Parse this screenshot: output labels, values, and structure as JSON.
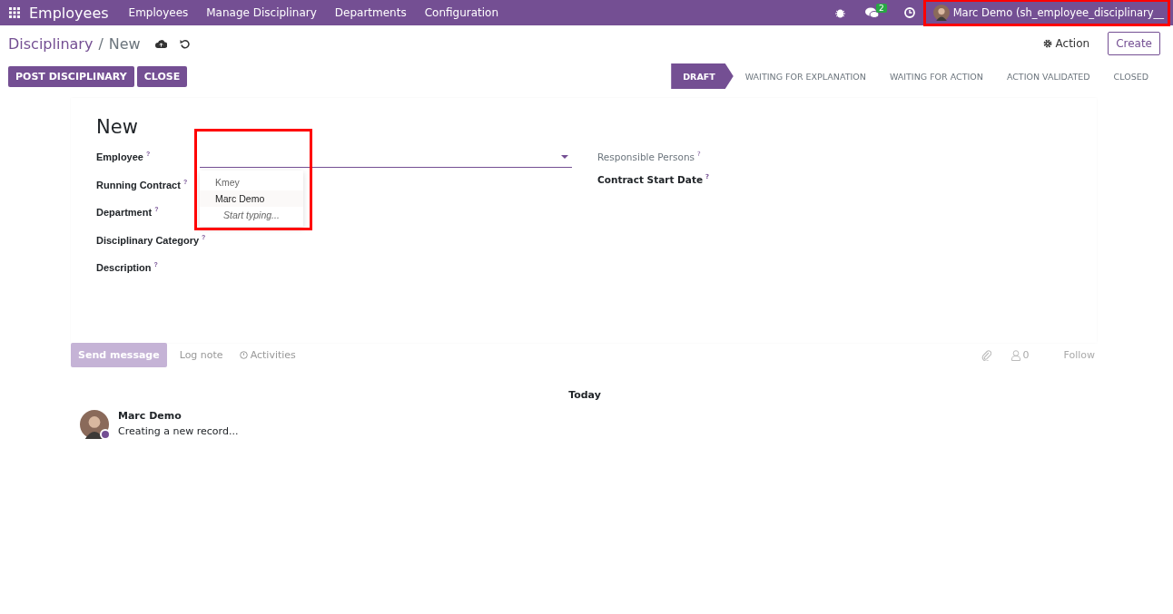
{
  "navbar": {
    "app_name": "Employees",
    "menu": [
      "Employees",
      "Manage Disciplinary",
      "Departments",
      "Configuration"
    ],
    "messages_count": "2",
    "user": {
      "name": "Marc Demo (sh_employee_disciplinary__",
      "highlighted": true
    }
  },
  "control_panel": {
    "breadcrumb_separator": "/",
    "breadcrumb": [
      {
        "label": "Disciplinary",
        "selected": false
      },
      {
        "label": "New",
        "selected": true
      }
    ],
    "action_label": "Action",
    "create_label": "Create"
  },
  "buttons": [
    "POST DISCIPLINARY",
    "CLOSE"
  ],
  "statusbar": [
    {
      "label": "DRAFT",
      "selected": true
    },
    {
      "label": "WAITING FOR EXPLANATION",
      "selected": false
    },
    {
      "label": "WAITING FOR ACTION",
      "selected": false
    },
    {
      "label": "ACTION VALIDATED",
      "selected": false
    },
    {
      "label": "CLOSED",
      "selected": false
    }
  ],
  "form": {
    "title": "New",
    "left_fields": [
      {
        "label": "Employee",
        "help": "?",
        "kind": "many2one"
      },
      {
        "label": "Running Contract",
        "help": "?",
        "kind": "plain"
      },
      {
        "label": "Department",
        "help": "?",
        "kind": "plain"
      },
      {
        "label": "Disciplinary Category",
        "help": "?",
        "kind": "plain"
      },
      {
        "label": "Description",
        "help": "?",
        "kind": "plain"
      }
    ],
    "right_fields": [
      {
        "label": "Responsible Persons",
        "help": "?",
        "muted": true
      },
      {
        "label": "Contract Start Date",
        "help": "?",
        "muted": false
      }
    ],
    "employee_dropdown": {
      "highlighted": true,
      "options": [
        {
          "label": "Kmey",
          "selected": false
        },
        {
          "label": "Marc Demo",
          "selected": true
        }
      ],
      "hint": "Start typing..."
    }
  },
  "chatter": {
    "send_message": {
      "label": "Send message",
      "disabled": true
    },
    "log_note": "Log note",
    "activities": "Activities",
    "followers_count": "0",
    "follow": "Follow",
    "date_separator": "Today",
    "messages": [
      {
        "author": "Marc Demo",
        "body": "Creating a new record..."
      }
    ]
  }
}
